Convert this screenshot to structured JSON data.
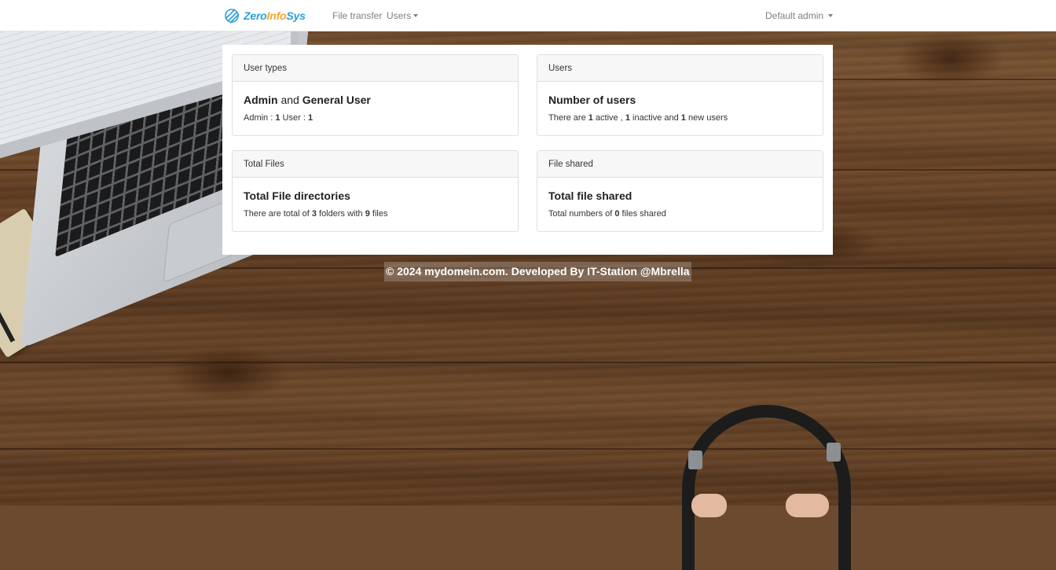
{
  "navbar": {
    "brand": {
      "part1": "Zero",
      "part2": "Info",
      "part3": "Sys"
    },
    "links": [
      {
        "label": "File transfer"
      },
      {
        "label": "Users"
      }
    ],
    "user_menu": "Default admin"
  },
  "cards": {
    "user_types": {
      "header": "User types",
      "title_a": "Admin",
      "title_join": " and ",
      "title_b": "General User",
      "admin_label": "Admin : ",
      "admin_count": "1",
      "user_label": " User : ",
      "user_count": "1"
    },
    "users": {
      "header": "Users",
      "title": "Number of users",
      "t1": "There are ",
      "active": "1",
      "t2": " active , ",
      "inactive": "1",
      "t3": " inactive and ",
      "new": "1",
      "t4": " new users"
    },
    "total_files": {
      "header": "Total Files",
      "title": "Total File directories",
      "t1": "There are total of ",
      "folders": "3",
      "t2": " folders with ",
      "files": "9",
      "t3": " files"
    },
    "file_shared": {
      "header": "File shared",
      "title": "Total file shared",
      "t1": "Total numbers of ",
      "shared": "0",
      "t2": " files shared"
    }
  },
  "footer": "© 2024 mydomein.com. Developed By IT-Station @Mbrella",
  "colors": {
    "brand_blue": "#2a9fd8",
    "brand_orange": "#f5a623"
  }
}
